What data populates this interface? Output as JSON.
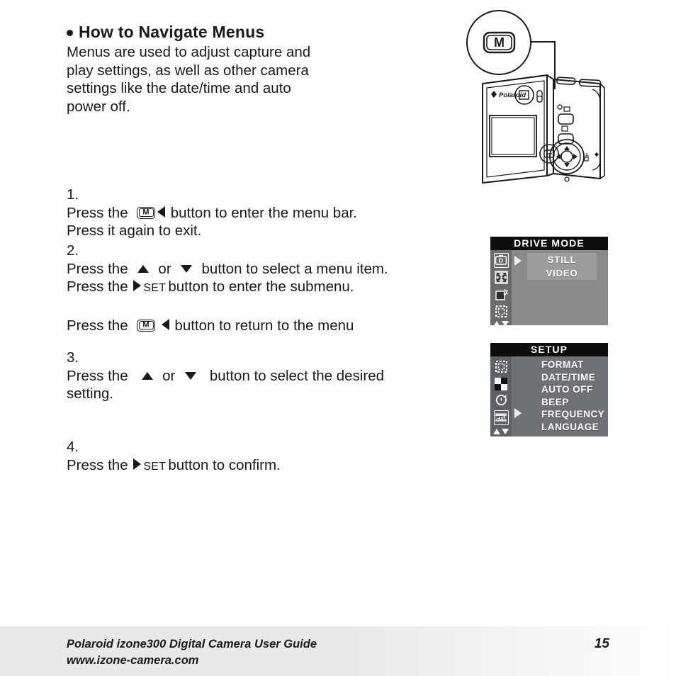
{
  "page": {
    "heading": "How to Navigate Menus",
    "intro_lines": [
      "Menus are used to adjust capture and",
      "play settings, as well as other camera",
      "settings like the date/time and auto",
      "power off."
    ]
  },
  "steps": [
    {
      "number": "1.",
      "line1_a": "Press the",
      "icon1": "m-button-icon",
      "icon2": "triangle-left-icon",
      "line1_b": "button to enter the menu bar.",
      "line2": "Press it again to exit."
    },
    {
      "number": "2.",
      "line1_a": "Press the",
      "line1_b": "or",
      "line1_c": "button to select a menu item.",
      "line2_a": "Press the",
      "set_label": "SET",
      "line2_b": "button to enter the submenu.",
      "line3_a": "Press the",
      "line3_b": "button to return to the menu"
    },
    {
      "number": "3.",
      "line1_a": "Press the",
      "line1_b": "or",
      "line1_c": "button to select the desired",
      "line2": "setting."
    },
    {
      "number": "4.",
      "line1_a": "Press the",
      "set_label": "SET",
      "line1_b": "button to confirm."
    }
  ],
  "camera_figure": {
    "callout_label": "M",
    "brand": "Polaroid",
    "alt": "Rear view of Polaroid izone300 camera with M button callout"
  },
  "menus": [
    {
      "id": "drive",
      "title": "DRIVE MODE",
      "rail_icons": [
        "drive-mode-icon",
        "resolution-icon",
        "quality-icon",
        "effects-icon"
      ],
      "selected_rail_index": 0,
      "scroll_hint": "up-down-arrows-icon",
      "pointer": "triangle-right-icon",
      "options": [
        "STILL",
        "VIDEO"
      ],
      "colors": {
        "title_bar": "#0d0d0d",
        "background": "#8a8a8a",
        "rail": "#6b6b6b",
        "submenu_box": "#9c9c9c",
        "text": "#ffffff"
      }
    },
    {
      "id": "setup",
      "title": "SETUP",
      "rail_icons": [
        "effects-icon",
        "bw-mode-icon",
        "self-timer-icon",
        "setup-icon"
      ],
      "selected_rail_index": 3,
      "setup_icon_label": "SETUP",
      "scroll_hint": "up-down-arrows-icon",
      "pointer": "triangle-right-icon",
      "pointer_target_index": 4,
      "options": [
        "FORMAT",
        "DATE/TIME",
        "AUTO OFF",
        "BEEP",
        "FREQUENCY",
        "LANGUAGE"
      ],
      "colors": {
        "title_bar": "#0d0d0d",
        "background": "#6e7276",
        "rail": "#5e6266",
        "text": "#ffffff"
      }
    }
  ],
  "footer": {
    "line1": "Polaroid izone300 Digital Camera User Guide",
    "line2": "www.izone-camera.com",
    "page_number": "15"
  }
}
